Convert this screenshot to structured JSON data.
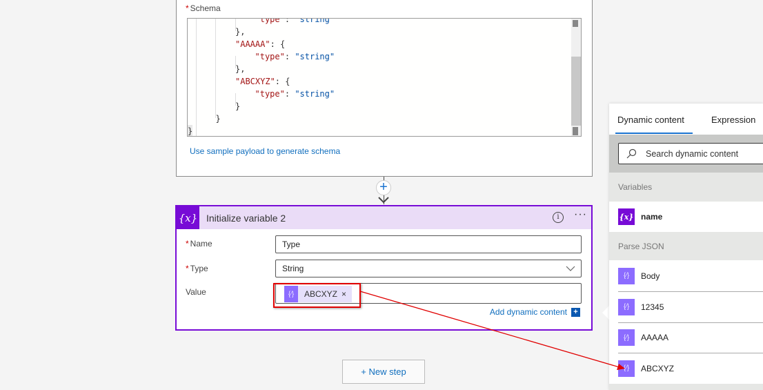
{
  "parse_json_card": {
    "schema_label": "Schema",
    "schema_lines": [
      {
        "indent": 3,
        "key": "\"type\"",
        "sep": ": ",
        "val": "\"string\""
      },
      {
        "indent": 2,
        "text": "},"
      },
      {
        "indent": 2,
        "key": "\"AAAAA\"",
        "sep": ": {",
        "val": ""
      },
      {
        "indent": 3,
        "key": "\"type\"",
        "sep": ": ",
        "val": "\"string\""
      },
      {
        "indent": 2,
        "text": "},"
      },
      {
        "indent": 2,
        "key": "\"ABCXYZ\"",
        "sep": ": {",
        "val": ""
      },
      {
        "indent": 3,
        "key": "\"type\"",
        "sep": ": ",
        "val": "\"string\""
      },
      {
        "indent": 2,
        "text": "}"
      },
      {
        "indent": 1,
        "text": "}"
      },
      {
        "indent": 0,
        "text": "}"
      }
    ],
    "sample_payload_link": "Use sample payload to generate schema"
  },
  "init_var_card": {
    "title": "Initialize variable 2",
    "icon": "{x}",
    "name_label": "Name",
    "name_value": "Type",
    "type_label": "Type",
    "type_value": "String",
    "value_label": "Value",
    "value_token": "ABCXYZ",
    "add_dynamic_content": "Add dynamic content"
  },
  "new_step_label": "+ New step",
  "dynamic_panel": {
    "tabs": [
      {
        "label": "Dynamic content",
        "active": true
      },
      {
        "label": "Expression",
        "active": false
      }
    ],
    "search_placeholder": "Search dynamic content",
    "sections": [
      {
        "header": "Variables",
        "items": [
          {
            "label": "name",
            "icon": "{x}"
          }
        ]
      },
      {
        "header": "Parse JSON",
        "items": [
          {
            "label": "Body"
          },
          {
            "label": "12345"
          },
          {
            "label": "AAAAA"
          },
          {
            "label": "ABCXYZ"
          }
        ]
      }
    ]
  },
  "colors": {
    "accent_purple": "#770bd6",
    "token_purple": "#8c6cff",
    "link_blue": "#106ebe",
    "annotation_red": "#e00000"
  }
}
